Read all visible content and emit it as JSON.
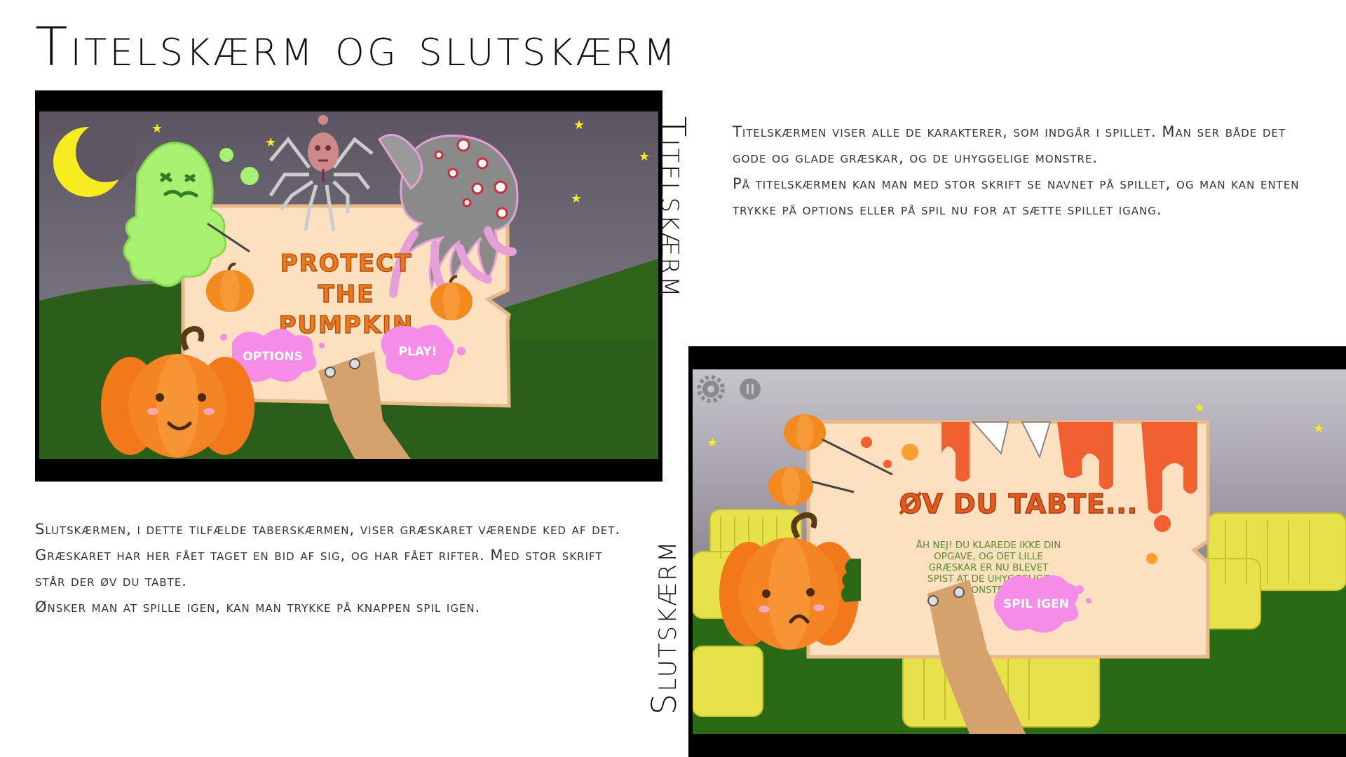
{
  "slide": {
    "title": "Titelskærm og slutskærm"
  },
  "title_screen": {
    "side_label": "Titelskærm",
    "description_lines": [
      "Titelskærmen viser alle de karakterer, som indgår i spillet. Man ser både det gode og glade græskar, og de uhyggelige monstre.",
      "På titelskærmen kan man med stor skrift se navnet på spillet, og man kan enten trykke på options eller på spil nu for at sætte spillet igang."
    ],
    "game": {
      "title_line1": "PROTECT",
      "title_line2": "THE",
      "title_line3": "PUMPKIN",
      "options_button": "OPTIONS",
      "play_button": "PLAY!",
      "colors": {
        "sky": "#6c6371",
        "grass": "#2a5e1a",
        "sign": "#fde0c0",
        "title": "#ec7a1c",
        "splat": "#f48ce8"
      }
    }
  },
  "end_screen": {
    "side_label": "Slutskærm",
    "description_lines": [
      "Slutskærmen, i dette tilfælde taberskærmen, viser græskaret værende ked af det. Græskaret har her fået taget en bid af sig, og har fået rifter. Med stor skrift står der øv du tabte.",
      "Ønsker man at spille igen, kan man trykke på knappen spil igen."
    ],
    "game": {
      "headline": "ØV DU TABTE...",
      "message_lines": [
        "ÅH NEJ! DU KLAREDE IKKE DIN",
        "OPGAVE, OG DET LILLE",
        "GRÆSKAR ER NU BLEVET",
        "SPIST AT DE UHYGGELIGE",
        "MONSTRE!"
      ],
      "replay_button": "SPIL IGEN",
      "icons": [
        "gear-icon",
        "pause-icon"
      ],
      "colors": {
        "headline": "#e35a1e",
        "message": "#5a8c2a",
        "drip": "#f06030",
        "hay": "#e8e24a"
      }
    }
  }
}
